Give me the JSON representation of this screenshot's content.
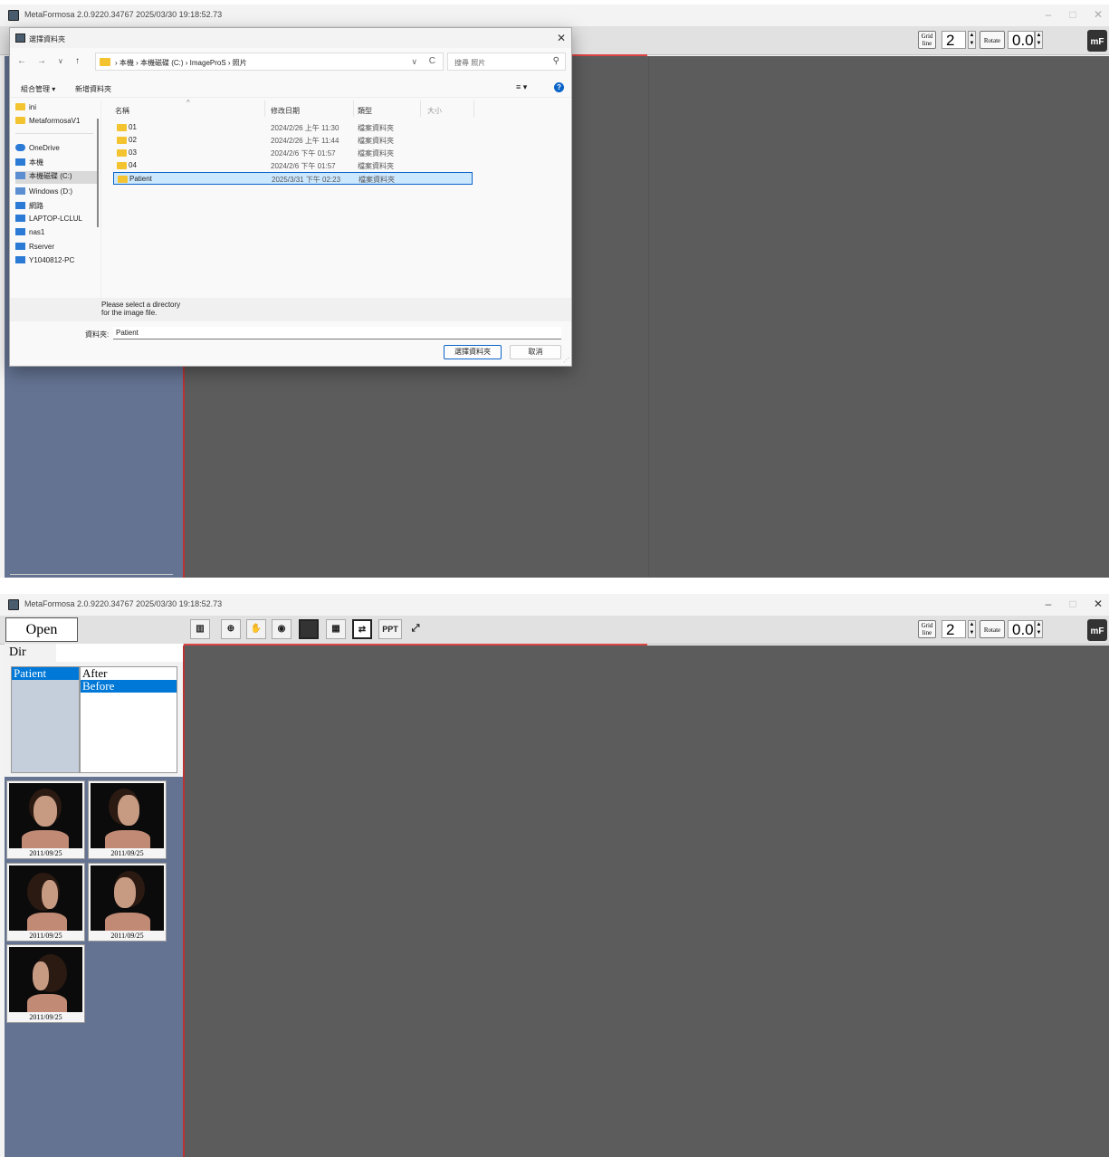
{
  "app": {
    "title": "MetaFormosa 2.0.9220.34767 2025/03/30 19:18:52.73",
    "minimize": "–",
    "maximize": "□",
    "close": "✕",
    "grid_label_1": "Grid",
    "grid_label_2": "line",
    "grid_value": "2",
    "rotate_label": "Rotate",
    "rotate_value": "0.0",
    "logo": "mF"
  },
  "dialog": {
    "title": "選擇資料夾",
    "close": "✕",
    "nav": {
      "back": "←",
      "forward": "→",
      "recent": "∨",
      "up": "↑"
    },
    "breadcrumb": "›  本機  ›  本機磁碟 (C:)  ›  ImageProS  ›  照片",
    "refresh": "C",
    "address_dropdown": "∨",
    "search_placeholder": "搜尋 照片",
    "search_icon": "⚲",
    "organize": "組合管理 ▾",
    "new_folder": "新增資料夾",
    "view_icon": "≡ ▾",
    "help_icon": "?",
    "sort_indicator": "^",
    "nav_items": [
      {
        "label": "ini",
        "icon": "folder-icon"
      },
      {
        "label": "MetaformosaV1",
        "icon": "folder-icon"
      },
      {
        "label": "OneDrive",
        "icon": "cloud-icon"
      },
      {
        "label": "本機",
        "icon": "pc-icon"
      },
      {
        "label": "本機磁碟 (C:)",
        "icon": "drive-icon"
      },
      {
        "label": "Windows (D:)",
        "icon": "drive-icon"
      },
      {
        "label": "網路",
        "icon": "network-icon"
      },
      {
        "label": "LAPTOP-LCLUL",
        "icon": "pc-icon"
      },
      {
        "label": "nas1",
        "icon": "pc-icon"
      },
      {
        "label": "Rserver",
        "icon": "pc-icon"
      },
      {
        "label": "Y1040812-PC",
        "icon": "pc-icon"
      }
    ],
    "columns": [
      "名稱",
      "修改日期",
      "類型",
      "大小"
    ],
    "files": [
      {
        "name": "01",
        "date": "2024/2/26 上午 11:30",
        "type": "檔案資料夾"
      },
      {
        "name": "02",
        "date": "2024/2/26 上午 11:44",
        "type": "檔案資料夾"
      },
      {
        "name": "03",
        "date": "2024/2/6 下午 01:57",
        "type": "檔案資料夾"
      },
      {
        "name": "04",
        "date": "2024/2/6 下午 01:57",
        "type": "檔案資料夾"
      },
      {
        "name": "Patient",
        "date": "2025/3/31 下午 02:23",
        "type": "檔案資料夾"
      }
    ],
    "status_message": "Please select a directory\nfor the image file.",
    "folder_label": "資料夾:",
    "folder_value": "Patient",
    "select_button": "選擇資料夾",
    "cancel_button": "取消"
  },
  "main": {
    "open_button": "Open",
    "dir_tab": "Dir",
    "dir_list": [
      "Patient"
    ],
    "sub_list": [
      "After",
      "Before"
    ],
    "sub_selected": "Before",
    "toolbar_ppt": "PPT",
    "thumbnails": [
      {
        "date": "2011/09/25",
        "view": "front"
      },
      {
        "date": "2011/09/25",
        "view": "oblique-right"
      },
      {
        "date": "2011/09/25",
        "view": "profile-right"
      },
      {
        "date": "2011/09/25",
        "view": "oblique-left"
      },
      {
        "date": "2011/09/25",
        "view": "profile-left"
      }
    ]
  },
  "colors": {
    "sidebar": "#647392",
    "canvas": "#5c5c5c",
    "selection": "#0078d7",
    "accent_red": "#b33333"
  }
}
